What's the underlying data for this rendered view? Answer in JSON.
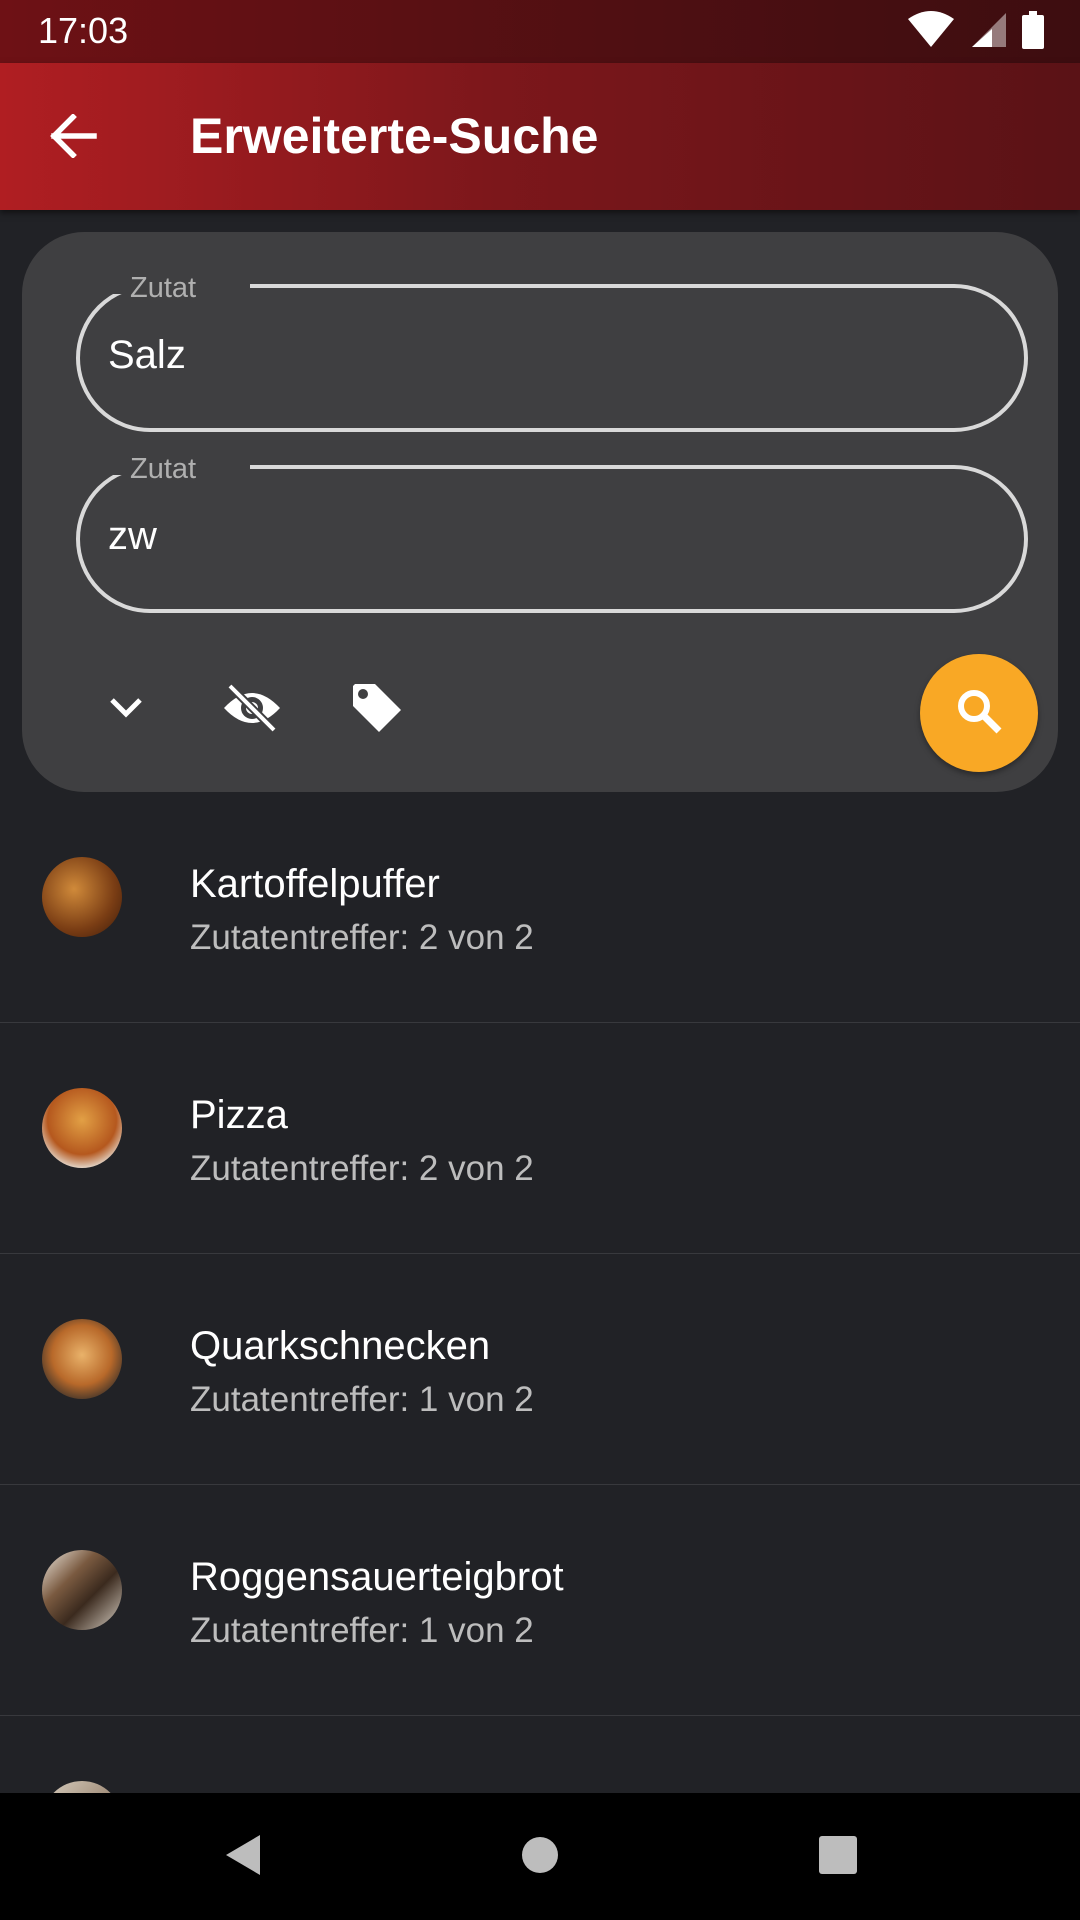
{
  "status_bar": {
    "time": "17:03",
    "icons": [
      "wifi-icon",
      "signal-icon",
      "battery-icon"
    ]
  },
  "app_bar": {
    "title": "Erweiterte-Suche",
    "back_icon": "arrow-back-icon"
  },
  "search": {
    "fields": [
      {
        "label": "Zutat",
        "value": "Salz"
      },
      {
        "label": "Zutat",
        "value": "zw"
      }
    ],
    "actions": {
      "expand_icon": "chevron-down-icon",
      "visibility_icon": "visibility-off-icon",
      "tag_icon": "tag-icon",
      "search_icon": "search-icon"
    },
    "accent_color": "#f9a825"
  },
  "results": [
    {
      "title": "Kartoffelpuffer",
      "subtitle": "Zutatentreffer: 2 von 2"
    },
    {
      "title": "Pizza",
      "subtitle": "Zutatentreffer: 2 von 2"
    },
    {
      "title": "Quarkschnecken",
      "subtitle": "Zutatentreffer: 1 von 2"
    },
    {
      "title": "Roggensauerteigbrot",
      "subtitle": "Zutatentreffer: 1 von 2"
    }
  ],
  "nav_bar": {
    "icons": [
      "back-triangle-icon",
      "home-circle-icon",
      "recents-square-icon"
    ]
  }
}
